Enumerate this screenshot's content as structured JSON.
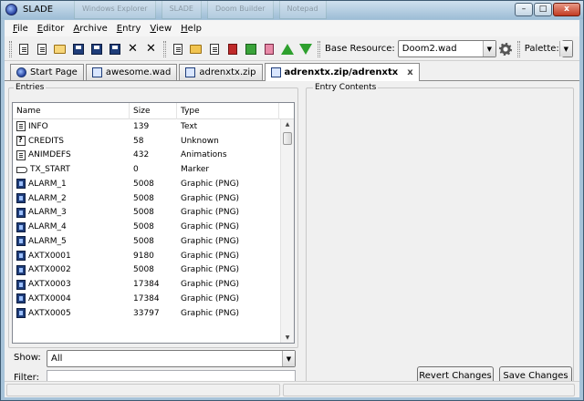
{
  "window": {
    "title": "SLADE",
    "background_tabs": [
      "Windows Explorer",
      "SLADE",
      "Doom Builder",
      "Notepad"
    ],
    "minimize_glyph": "–",
    "maximize_glyph": "□",
    "close_glyph": "x"
  },
  "menu": [
    {
      "key": "F",
      "rest": "ile"
    },
    {
      "key": "E",
      "rest": "ditor"
    },
    {
      "key": "A",
      "rest": "rchive"
    },
    {
      "key": "E",
      "rest": "ntry"
    },
    {
      "key": "V",
      "rest": "iew"
    },
    {
      "key": "H",
      "rest": "elp"
    }
  ],
  "toolbar": {
    "base_resource_label": "Base Resource:",
    "base_resource_value": "Doom2.wad",
    "palette_label": "Palette:",
    "palette_value": "",
    "delete_glyph": "✕"
  },
  "tabs": [
    {
      "label": "Start Page",
      "icon": "slade-icon",
      "active": false
    },
    {
      "label": "awesome.wad",
      "icon": "wad-icon",
      "active": false
    },
    {
      "label": "adrenxtx.zip",
      "icon": "zip-icon",
      "active": false
    },
    {
      "label": "adrenxtx.zip/adrenxtx",
      "icon": "wad-icon",
      "active": true
    }
  ],
  "tab_close_glyph": "x",
  "entries_panel": {
    "title": "Entries",
    "columns": {
      "name": "Name",
      "size": "Size",
      "type": "Type"
    },
    "rows": [
      {
        "name": "INFO",
        "size": "139",
        "type": "Text",
        "icon": "text"
      },
      {
        "name": "CREDITS",
        "size": "58",
        "type": "Unknown",
        "icon": "unknown"
      },
      {
        "name": "ANIMDEFS",
        "size": "432",
        "type": "Animations",
        "icon": "text"
      },
      {
        "name": "TX_START",
        "size": "0",
        "type": "Marker",
        "icon": "marker"
      },
      {
        "name": "ALARM_1",
        "size": "5008",
        "type": "Graphic (PNG)",
        "icon": "png"
      },
      {
        "name": "ALARM_2",
        "size": "5008",
        "type": "Graphic (PNG)",
        "icon": "png"
      },
      {
        "name": "ALARM_3",
        "size": "5008",
        "type": "Graphic (PNG)",
        "icon": "png"
      },
      {
        "name": "ALARM_4",
        "size": "5008",
        "type": "Graphic (PNG)",
        "icon": "png"
      },
      {
        "name": "ALARM_5",
        "size": "5008",
        "type": "Graphic (PNG)",
        "icon": "png"
      },
      {
        "name": "AXTX0001",
        "size": "9180",
        "type": "Graphic (PNG)",
        "icon": "png"
      },
      {
        "name": "AXTX0002",
        "size": "5008",
        "type": "Graphic (PNG)",
        "icon": "png"
      },
      {
        "name": "AXTX0003",
        "size": "17384",
        "type": "Graphic (PNG)",
        "icon": "png"
      },
      {
        "name": "AXTX0004",
        "size": "17384",
        "type": "Graphic (PNG)",
        "icon": "png"
      },
      {
        "name": "AXTX0005",
        "size": "33797",
        "type": "Graphic (PNG)",
        "icon": "png"
      }
    ],
    "scroll_up_glyph": "▲",
    "scroll_down_glyph": "▼",
    "show_label": "Show:",
    "show_value": "All",
    "filter_label": "Filter:",
    "filter_value": ""
  },
  "contents_panel": {
    "title": "Entry Contents",
    "revert_label": "Revert Changes",
    "save_label": "Save Changes"
  },
  "dropdown_glyph": "▼"
}
